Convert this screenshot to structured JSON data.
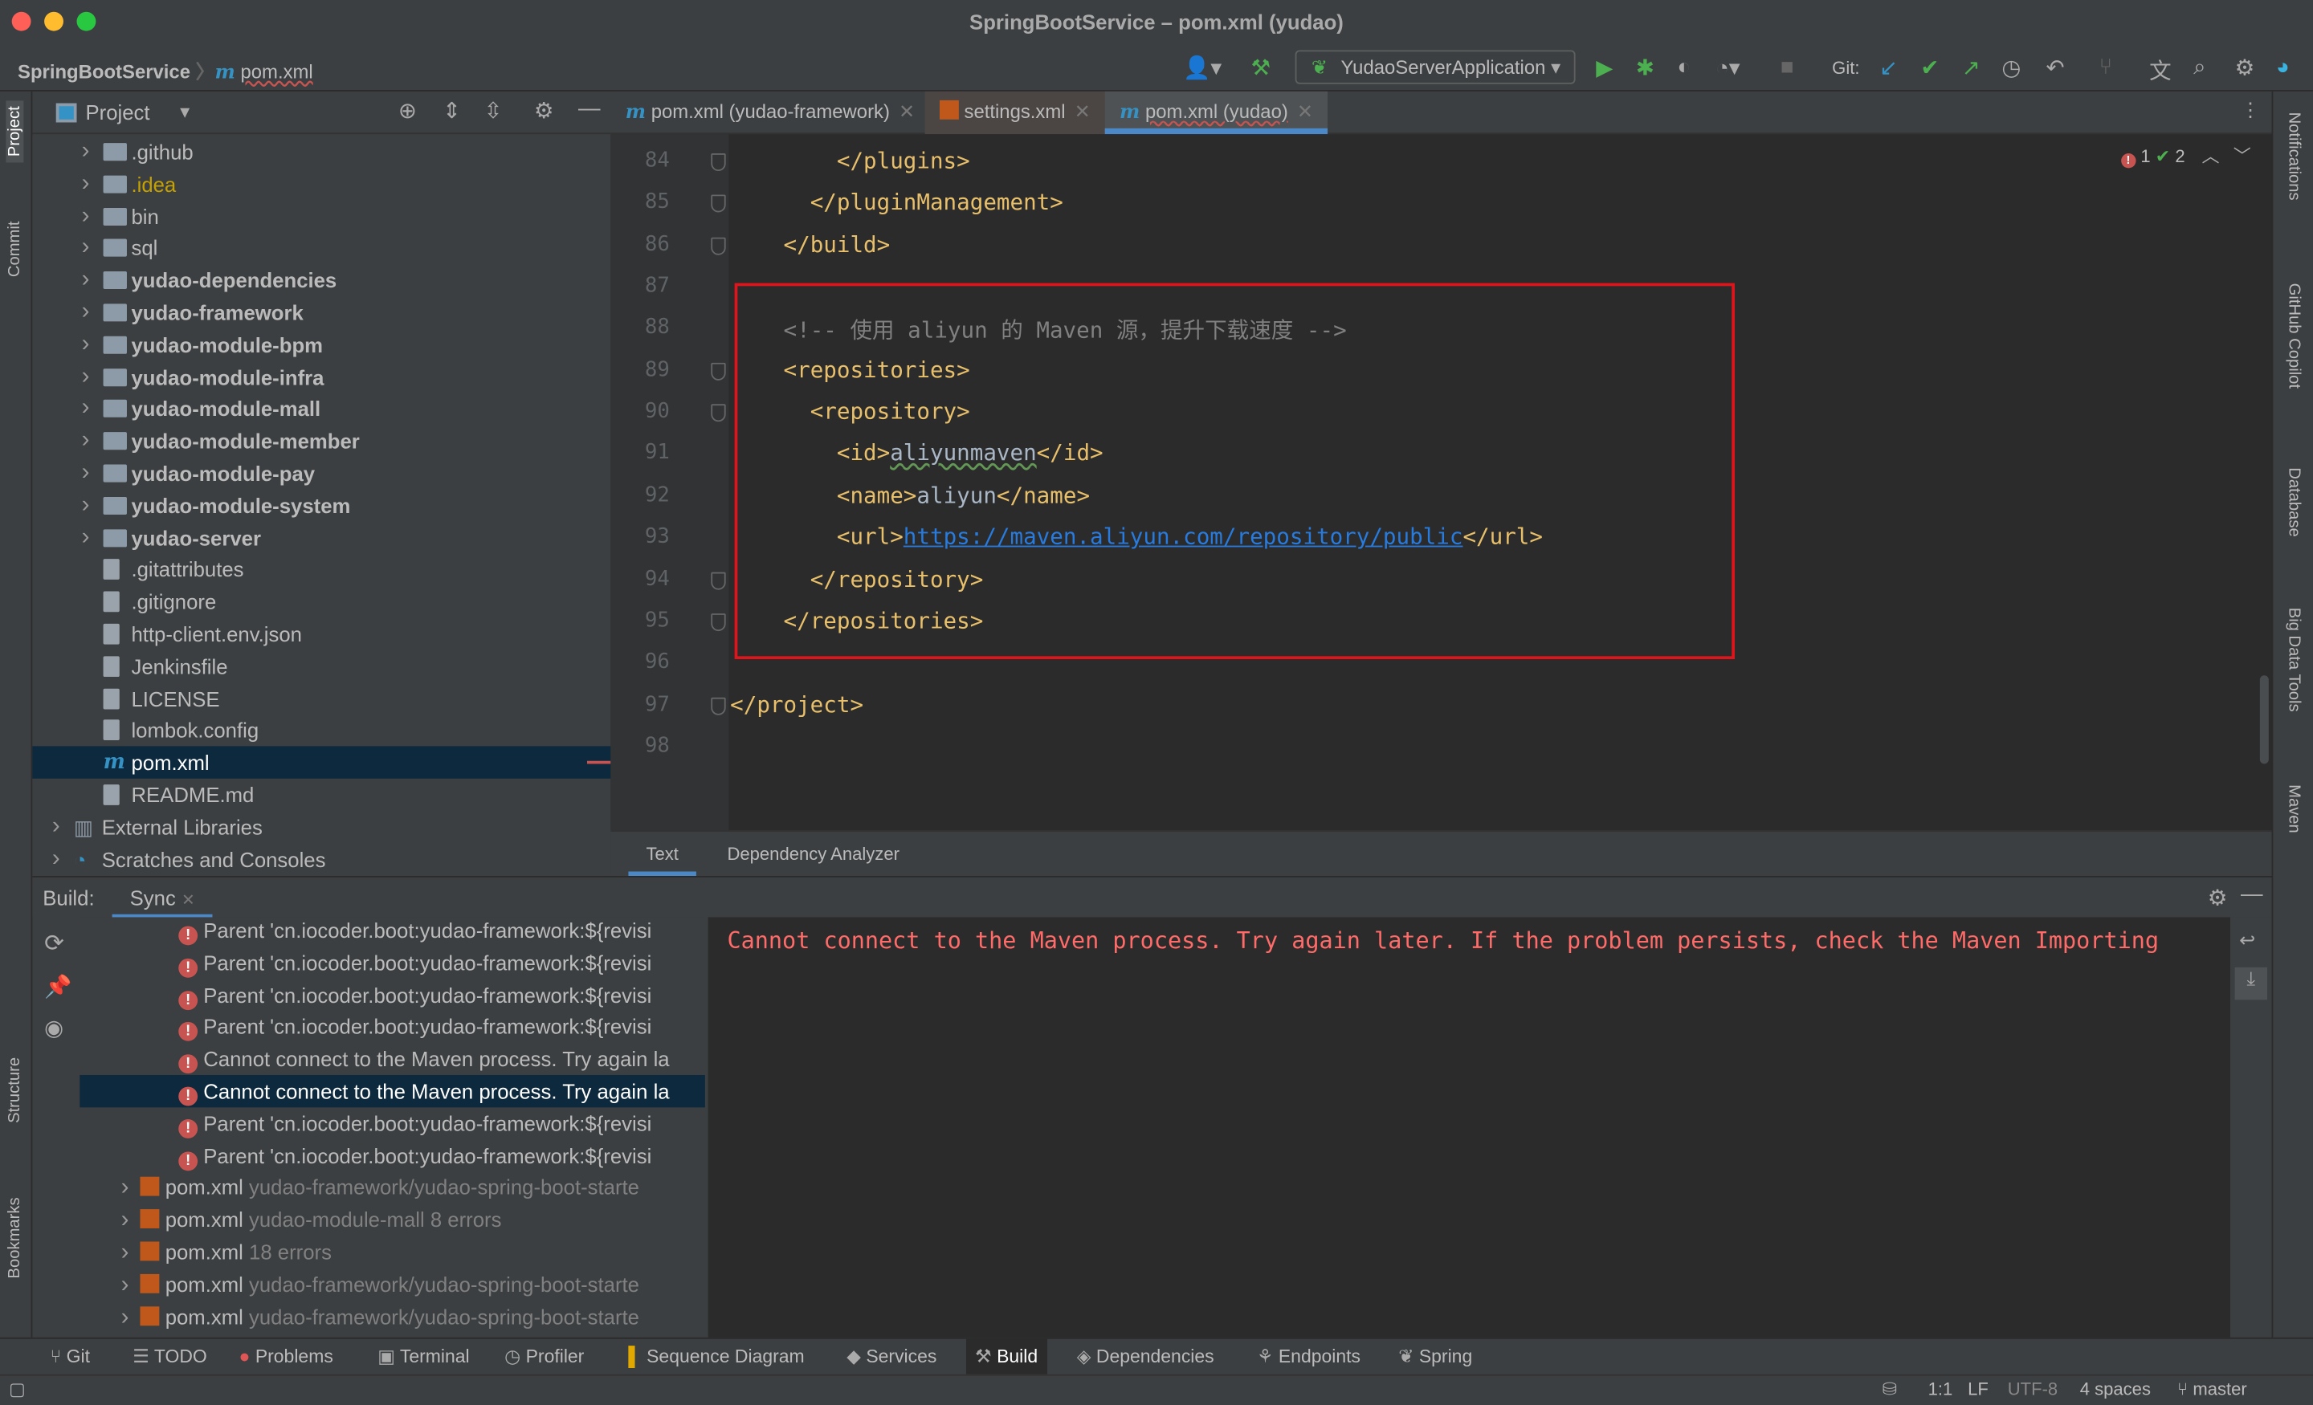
{
  "window": {
    "title": "SpringBootService – pom.xml (yudao)"
  },
  "toolbar": {
    "project": "SpringBootService",
    "file": "pom.xml",
    "run_config": "YudaoServerApplication",
    "git_label": "Git:"
  },
  "project_panel": {
    "title": "Project",
    "items": [
      {
        "label": ".github",
        "type": "folder",
        "bold": false,
        "expandable": true
      },
      {
        "label": ".idea",
        "type": "folder",
        "bold": false,
        "expandable": true,
        "color": "#c4a000"
      },
      {
        "label": "bin",
        "type": "folder",
        "bold": false,
        "expandable": true
      },
      {
        "label": "sql",
        "type": "folder",
        "bold": false,
        "expandable": true
      },
      {
        "label": "yudao-dependencies",
        "type": "module",
        "bold": true,
        "expandable": true
      },
      {
        "label": "yudao-framework",
        "type": "module",
        "bold": true,
        "expandable": true
      },
      {
        "label": "yudao-module-bpm",
        "type": "module",
        "bold": true,
        "expandable": true
      },
      {
        "label": "yudao-module-infra",
        "type": "module",
        "bold": true,
        "expandable": true
      },
      {
        "label": "yudao-module-mall",
        "type": "module",
        "bold": true,
        "expandable": true
      },
      {
        "label": "yudao-module-member",
        "type": "module",
        "bold": true,
        "expandable": true
      },
      {
        "label": "yudao-module-pay",
        "type": "module",
        "bold": true,
        "expandable": true
      },
      {
        "label": "yudao-module-system",
        "type": "module",
        "bold": true,
        "expandable": true
      },
      {
        "label": "yudao-server",
        "type": "module",
        "bold": true,
        "expandable": true
      },
      {
        "label": ".gitattributes",
        "type": "file"
      },
      {
        "label": ".gitignore",
        "type": "file"
      },
      {
        "label": "http-client.env.json",
        "type": "file"
      },
      {
        "label": "Jenkinsfile",
        "type": "file"
      },
      {
        "label": "LICENSE",
        "type": "file"
      },
      {
        "label": "lombok.config",
        "type": "file"
      },
      {
        "label": "pom.xml",
        "type": "maven",
        "selected": true
      },
      {
        "label": "README.md",
        "type": "file"
      },
      {
        "label": "External Libraries",
        "type": "lib",
        "expandable": true,
        "root": true
      },
      {
        "label": "Scratches and Consoles",
        "type": "scratch",
        "expandable": true,
        "root": true
      }
    ]
  },
  "editor": {
    "tabs": [
      {
        "label": "pom.xml (yudao-framework)",
        "icon": "maven"
      },
      {
        "label": "settings.xml",
        "icon": "xml"
      },
      {
        "label": "pom.xml (yudao)",
        "icon": "maven",
        "active": true
      }
    ],
    "inspections": {
      "errors": "1",
      "ok": "2"
    },
    "lines": [
      {
        "n": "84",
        "indent": "        ",
        "parts": [
          [
            "</plugins>",
            "tag"
          ]
        ]
      },
      {
        "n": "85",
        "indent": "      ",
        "parts": [
          [
            "</pluginManagement>",
            "tag"
          ]
        ]
      },
      {
        "n": "86",
        "indent": "    ",
        "parts": [
          [
            "</build>",
            "tag"
          ]
        ]
      },
      {
        "n": "87",
        "indent": "",
        "parts": []
      },
      {
        "n": "88",
        "indent": "    ",
        "parts": [
          [
            "<!-- 使用 aliyun 的 Maven 源，提升下载速度 -->",
            "comment"
          ]
        ]
      },
      {
        "n": "89",
        "indent": "    ",
        "parts": [
          [
            "<repositories>",
            "tag"
          ]
        ]
      },
      {
        "n": "90",
        "indent": "      ",
        "parts": [
          [
            "<repository>",
            "tag"
          ]
        ]
      },
      {
        "n": "91",
        "indent": "        ",
        "parts": [
          [
            "<id>",
            "tag"
          ],
          [
            "aliyunmaven",
            "text"
          ],
          [
            "</id>",
            "tag"
          ]
        ]
      },
      {
        "n": "92",
        "indent": "        ",
        "parts": [
          [
            "<name>",
            "tag"
          ],
          [
            "aliyun",
            "text"
          ],
          [
            "</name>",
            "tag"
          ]
        ]
      },
      {
        "n": "93",
        "indent": "        ",
        "parts": [
          [
            "<url>",
            "tag"
          ],
          [
            "https://maven.aliyun.com/repository/public",
            "url"
          ],
          [
            "</url>",
            "tag"
          ]
        ]
      },
      {
        "n": "94",
        "indent": "      ",
        "parts": [
          [
            "</repository>",
            "tag"
          ]
        ]
      },
      {
        "n": "95",
        "indent": "    ",
        "parts": [
          [
            "</repositories>",
            "tag"
          ]
        ]
      },
      {
        "n": "96",
        "indent": "",
        "parts": []
      },
      {
        "n": "97",
        "indent": "",
        "parts": [
          [
            "</project>",
            "tag"
          ]
        ]
      },
      {
        "n": "98",
        "indent": "",
        "parts": []
      }
    ],
    "bottom_tabs": [
      "Text",
      "Dependency Analyzer"
    ]
  },
  "build": {
    "label": "Build:",
    "tab": "Sync",
    "rows": [
      {
        "text": "Parent 'cn.iocoder.boot:yudao-framework:${revisi",
        "kind": "error"
      },
      {
        "text": "Parent 'cn.iocoder.boot:yudao-framework:${revisi",
        "kind": "error"
      },
      {
        "text": "Parent 'cn.iocoder.boot:yudao-framework:${revisi",
        "kind": "error"
      },
      {
        "text": "Parent 'cn.iocoder.boot:yudao-framework:${revisi",
        "kind": "error"
      },
      {
        "text": "Cannot connect to the Maven process. Try again la",
        "kind": "error"
      },
      {
        "text": "Cannot connect to the Maven process. Try again la",
        "kind": "error",
        "selected": true
      },
      {
        "text": "Parent 'cn.iocoder.boot:yudao-framework:${revisi",
        "kind": "error"
      },
      {
        "text": "Parent 'cn.iocoder.boot:yudao-framework:${revisi",
        "kind": "error"
      },
      {
        "text": "pom.xml",
        "detail": "yudao-framework/yudao-spring-boot-starte",
        "kind": "file"
      },
      {
        "text": "pom.xml",
        "detail": "yudao-module-mall 8 errors",
        "kind": "file"
      },
      {
        "text": "pom.xml",
        "detail": " 18 errors",
        "kind": "file"
      },
      {
        "text": "pom.xml",
        "detail": "yudao-framework/yudao-spring-boot-starte",
        "kind": "file"
      },
      {
        "text": "pom.xml",
        "detail": "yudao-framework/yudao-spring-boot-starte",
        "kind": "file"
      }
    ],
    "console": "Cannot connect to the Maven process. Try again later. If the problem persists, check the Maven Importing"
  },
  "left_stripe": [
    "Project",
    "Commit",
    "Structure",
    "Bookmarks"
  ],
  "right_stripe": [
    "Notifications",
    "GitHub Copilot",
    "Database",
    "Big Data Tools",
    "Maven"
  ],
  "tool_windows": [
    "Git",
    "TODO",
    "Problems",
    "Terminal",
    "Profiler",
    "Sequence Diagram",
    "Services",
    "Build",
    "Dependencies",
    "Endpoints",
    "Spring"
  ],
  "status": {
    "position": "1:1",
    "line_sep": "LF",
    "encoding": "UTF-8",
    "indent": "4 spaces",
    "branch": "master"
  },
  "colors": {
    "accent": "#3592c4",
    "error": "#e0151b",
    "selection": "#0d293e"
  }
}
